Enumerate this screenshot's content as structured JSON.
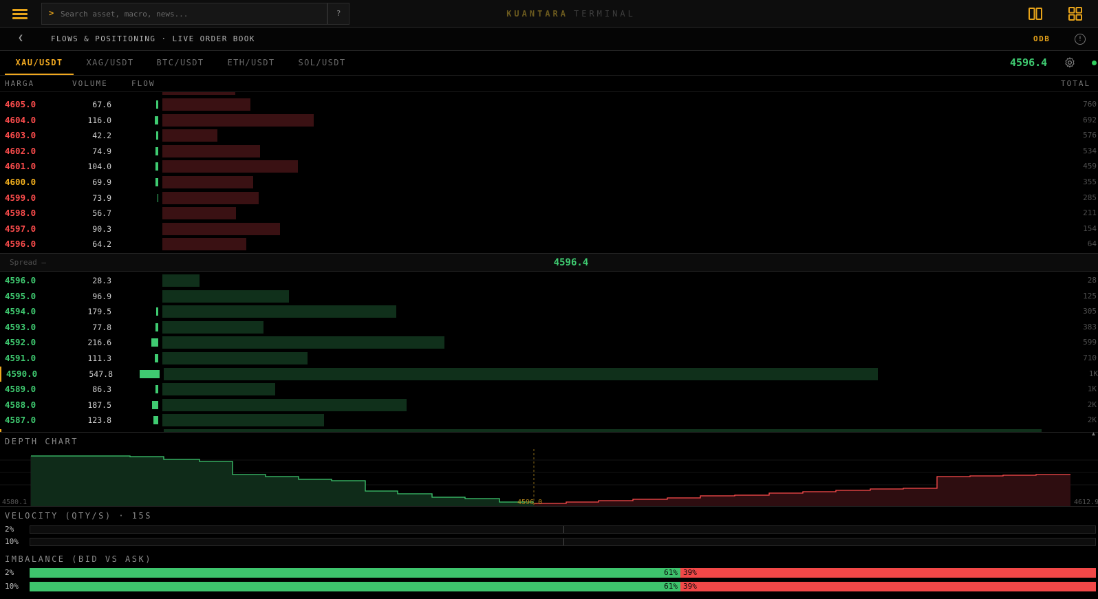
{
  "topbar": {
    "search_placeholder": "Search asset, macro, news...",
    "search_prompt": ">",
    "help_label": "?",
    "brand_main": "KUANTARA",
    "brand_sub": "TERMINAL",
    "icons": [
      "menu-icon",
      "columns-icon",
      "grid-icon"
    ]
  },
  "subheader": {
    "title": "FLOWS & POSITIONING · LIVE ORDER BOOK",
    "badge": "ODB",
    "back_icon": "chevron-left-icon",
    "info_icon": "info-icon"
  },
  "tabs": [
    {
      "label": "XAU/USDT",
      "active": true
    },
    {
      "label": "XAG/USDT",
      "active": false
    },
    {
      "label": "BTC/USDT",
      "active": false
    },
    {
      "label": "ETH/USDT",
      "active": false
    },
    {
      "label": "SOL/USDT",
      "active": false
    }
  ],
  "last_price": "4596.4",
  "columns": {
    "price": "HARGA",
    "volume": "VOLUME",
    "flow": "FLOW",
    "total": "TOTAL"
  },
  "asks": [
    {
      "price": "4605.0",
      "volume": "67.6",
      "total": "760",
      "flow": 1,
      "highlight": false
    },
    {
      "price": "4604.0",
      "volume": "116.0",
      "total": "692",
      "flow": 2,
      "highlight": false
    },
    {
      "price": "4603.0",
      "volume": "42.2",
      "total": "576",
      "flow": 1,
      "highlight": false
    },
    {
      "price": "4602.0",
      "volume": "74.9",
      "total": "534",
      "flow": 1.5,
      "highlight": false
    },
    {
      "price": "4601.0",
      "volume": "104.0",
      "total": "459",
      "flow": 1.5,
      "highlight": false
    },
    {
      "price": "4600.0",
      "volume": "69.9",
      "total": "355",
      "flow": 1.5,
      "highlight": true
    },
    {
      "price": "4599.0",
      "volume": "73.9",
      "total": "285",
      "flow": 0.5,
      "highlight": false
    },
    {
      "price": "4598.0",
      "volume": "56.7",
      "total": "211",
      "flow": 0,
      "highlight": false
    },
    {
      "price": "4597.0",
      "volume": "90.3",
      "total": "154",
      "flow": 0,
      "highlight": false
    },
    {
      "price": "4596.0",
      "volume": "64.2",
      "total": "64",
      "flow": 0,
      "highlight": false
    }
  ],
  "spread": {
    "label": "Spread —",
    "mid": "4596.4"
  },
  "bids": [
    {
      "price": "4596.0",
      "volume": "28.3",
      "total": "28",
      "flow": 0,
      "mark": false
    },
    {
      "price": "4595.0",
      "volume": "96.9",
      "total": "125",
      "flow": 0,
      "mark": false
    },
    {
      "price": "4594.0",
      "volume": "179.5",
      "total": "305",
      "flow": 1,
      "mark": false
    },
    {
      "price": "4593.0",
      "volume": "77.8",
      "total": "383",
      "flow": 1.5,
      "mark": false
    },
    {
      "price": "4592.0",
      "volume": "216.6",
      "total": "599",
      "flow": 4,
      "mark": false
    },
    {
      "price": "4591.0",
      "volume": "111.3",
      "total": "710",
      "flow": 2,
      "mark": false
    },
    {
      "price": "4590.0",
      "volume": "547.8",
      "total": "1K",
      "flow": 11,
      "mark": true
    },
    {
      "price": "4589.0",
      "volume": "86.3",
      "total": "1K",
      "flow": 1.5,
      "mark": false
    },
    {
      "price": "4588.0",
      "volume": "187.5",
      "total": "2K",
      "flow": 3.5,
      "mark": false
    },
    {
      "price": "4587.0",
      "volume": "123.8",
      "total": "2K",
      "flow": 2.5,
      "mark": false
    }
  ],
  "depth_chart": {
    "title": "DEPTH CHART",
    "x_min": "4580.1",
    "x_max": "4612.9",
    "mid_label": "4596.0",
    "collapse_icon": "caret-up-icon",
    "bid_color": "#3fcb71",
    "ask_color": "#ff4d4d"
  },
  "velocity": {
    "title": "VELOCITY (QTY/S) · 15S",
    "rows": [
      {
        "label": "2%"
      },
      {
        "label": "10%"
      }
    ]
  },
  "imbalance": {
    "title": "IMBALANCE (BID VS ASK)",
    "rows": [
      {
        "label": "2%",
        "bid_pct": 61,
        "ask_pct": 39,
        "bid_text": "61%",
        "ask_text": "39%"
      },
      {
        "label": "10%",
        "bid_pct": 61,
        "ask_pct": 39,
        "bid_text": "61%",
        "ask_text": "39%"
      }
    ]
  }
}
